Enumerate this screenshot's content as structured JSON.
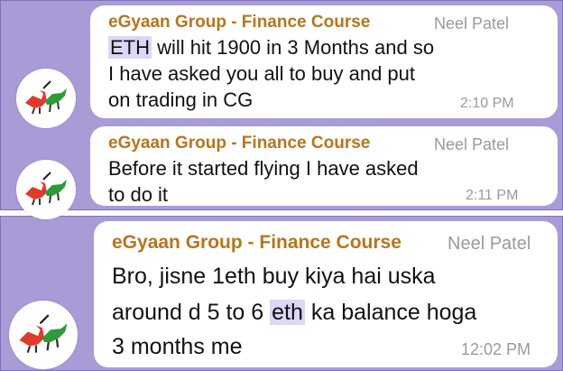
{
  "messages": [
    {
      "sender": "eGyaan Group - Finance Course",
      "role": "Neel Patel",
      "lines": [
        {
          "highlight": "ETH",
          "rest": " will hit 1900 in 3 Months and so"
        },
        {
          "text": "I have asked you all to buy and put"
        },
        {
          "text": "on trading in CG"
        }
      ],
      "time": "2:10 PM"
    },
    {
      "sender": "eGyaan Group - Finance Course",
      "role": "Neel Patel",
      "lines": [
        {
          "text": "Before it started flying I have asked"
        },
        {
          "text": "to do it"
        }
      ],
      "time": "2:11 PM"
    },
    {
      "sender": "eGyaan Group - Finance Course",
      "role": "Neel Patel",
      "lines": [
        {
          "text": "Bro, jisne 1eth buy kiya hai uska"
        },
        {
          "before": "around d 5 to 6 ",
          "highlight": "eth",
          "after": " ka balance hoga"
        },
        {
          "text": "3 months me"
        }
      ],
      "time": "12:02 PM"
    }
  ],
  "avatar_icon": "bull-bear-icon",
  "colors": {
    "background": "#a99bd6",
    "bubble": "#ffffff",
    "sender": "#b7751f",
    "meta": "#9a9a9a",
    "highlight": "#ddd6f5"
  }
}
